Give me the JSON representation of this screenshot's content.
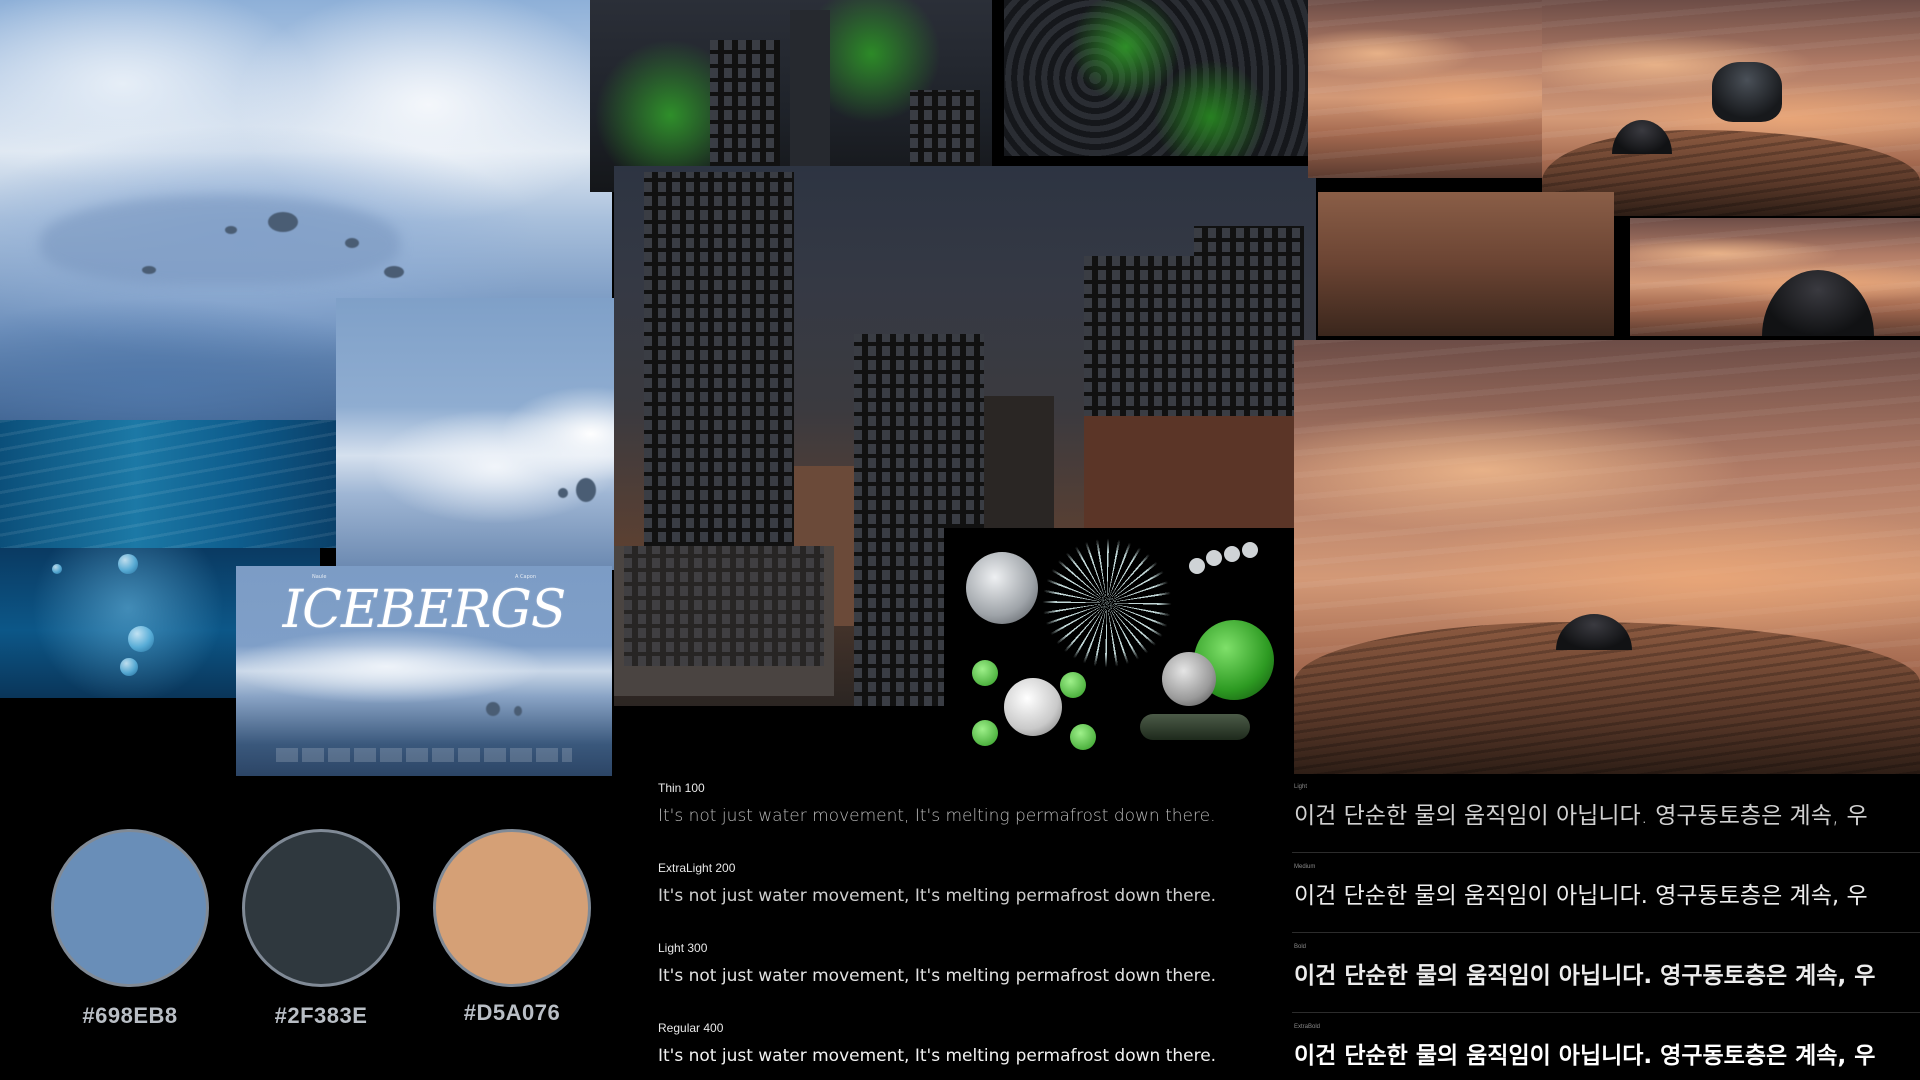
{
  "palette": {
    "swatches": [
      {
        "hex": "#698EB8",
        "color": "#698EB8"
      },
      {
        "hex": "#2F383E",
        "color": "#2F383E"
      },
      {
        "hex": "#D5A076",
        "color": "#D5A076"
      }
    ]
  },
  "poster": {
    "title": "ICEBERGS",
    "corner_left": "Naule",
    "corner_right": "A Capon"
  },
  "latin_specimens": [
    {
      "weight": "Thin 100",
      "sample": "It's not just water movement, It's melting permafrost down there."
    },
    {
      "weight": "ExtraLight 200",
      "sample": "It's not just water movement, It's melting permafrost down there."
    },
    {
      "weight": "Light 300",
      "sample": "It's not just water movement, It's melting permafrost down there."
    },
    {
      "weight": "Regular 400",
      "sample": "It's not just water movement, It's melting permafrost down there."
    }
  ],
  "korean_specimens": [
    {
      "weight": "Light",
      "sample": "이건 단순한 물의 움직임이 아닙니다. 영구동토층은 계속, 우"
    },
    {
      "weight": "Medium",
      "sample": "이건 단순한 물의 움직임이 아닙니다. 영구동토층은 계속, 우"
    },
    {
      "weight": "Bold",
      "sample": "이건 단순한 물의 움직임이 아닙니다. 영구동토층은 계속, 우"
    },
    {
      "weight": "ExtraBold",
      "sample": "이건 단순한 물의 움직임이 아닙니다. 영구동토층은 계속, 우"
    }
  ]
}
